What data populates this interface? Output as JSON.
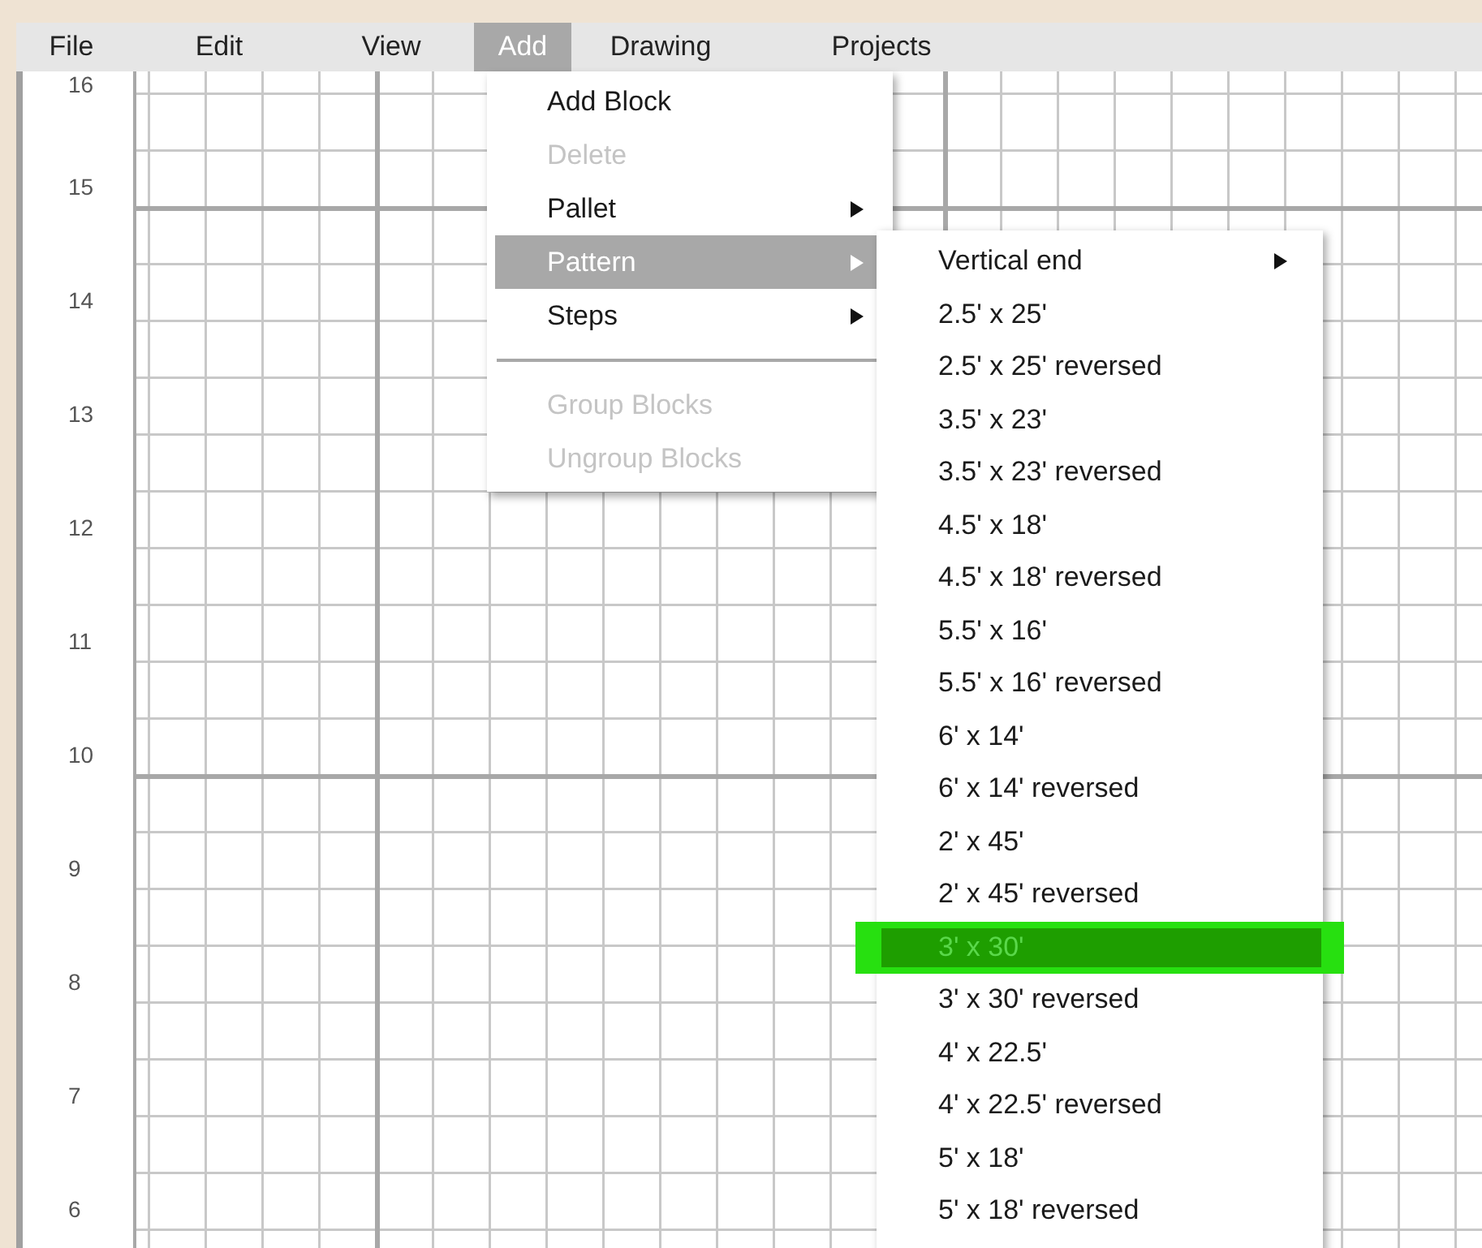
{
  "menubar": [
    {
      "label": "File",
      "selected": false
    },
    {
      "label": "Edit",
      "selected": false
    },
    {
      "label": "View",
      "selected": false
    },
    {
      "label": "Add",
      "selected": true
    },
    {
      "label": "Drawing",
      "selected": false
    },
    {
      "label": "Projects",
      "selected": false
    }
  ],
  "ruler": [
    "16",
    "15",
    "14",
    "13",
    "12",
    "11",
    "10",
    "9",
    "8",
    "7",
    "6"
  ],
  "add_menu": {
    "items": [
      {
        "kind": "item",
        "label": "Add Block",
        "disabled": false,
        "selected": false,
        "submenu": false
      },
      {
        "kind": "item",
        "label": "Delete",
        "disabled": true,
        "selected": false,
        "submenu": false
      },
      {
        "kind": "item",
        "label": "Pallet",
        "disabled": false,
        "selected": false,
        "submenu": true
      },
      {
        "kind": "item",
        "label": "Pattern",
        "disabled": false,
        "selected": true,
        "submenu": true
      },
      {
        "kind": "item",
        "label": "Steps",
        "disabled": false,
        "selected": false,
        "submenu": true
      },
      {
        "kind": "separator"
      },
      {
        "kind": "item",
        "label": "Group Blocks",
        "disabled": true,
        "selected": false,
        "submenu": false
      },
      {
        "kind": "item",
        "label": "Ungroup Blocks",
        "disabled": true,
        "selected": false,
        "submenu": false
      }
    ]
  },
  "pattern_submenu": {
    "items": [
      {
        "label": "Vertical end",
        "selected": false,
        "submenu": true
      },
      {
        "label": "2.5' x 25'",
        "selected": false,
        "submenu": false
      },
      {
        "label": "2.5' x 25' reversed",
        "selected": false,
        "submenu": false
      },
      {
        "label": "3.5' x 23'",
        "selected": false,
        "submenu": false
      },
      {
        "label": "3.5' x 23' reversed",
        "selected": false,
        "submenu": false
      },
      {
        "label": "4.5' x 18'",
        "selected": false,
        "submenu": false
      },
      {
        "label": "4.5' x 18' reversed",
        "selected": false,
        "submenu": false
      },
      {
        "label": "5.5' x 16'",
        "selected": false,
        "submenu": false
      },
      {
        "label": "5.5' x 16' reversed",
        "selected": false,
        "submenu": false
      },
      {
        "label": "6' x 14'",
        "selected": false,
        "submenu": false
      },
      {
        "label": "6' x 14' reversed",
        "selected": false,
        "submenu": false
      },
      {
        "label": "2' x 45'",
        "selected": false,
        "submenu": false
      },
      {
        "label": "2' x 45' reversed",
        "selected": false,
        "submenu": false
      },
      {
        "label": "3' x 30'",
        "selected": true,
        "submenu": false
      },
      {
        "label": "3' x 30' reversed",
        "selected": false,
        "submenu": false
      },
      {
        "label": "4' x 22.5'",
        "selected": false,
        "submenu": false
      },
      {
        "label": "4' x 22.5' reversed",
        "selected": false,
        "submenu": false
      },
      {
        "label": "5' x 18'",
        "selected": false,
        "submenu": false
      },
      {
        "label": "5' x 18' reversed",
        "selected": false,
        "submenu": false
      }
    ]
  }
}
